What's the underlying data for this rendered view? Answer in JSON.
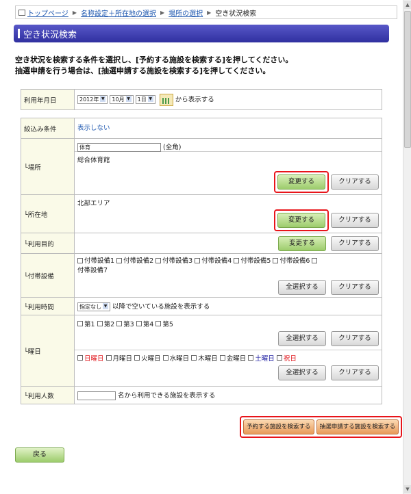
{
  "breadcrumb": {
    "items": [
      "トップページ",
      "名称設定＋所在地の選択",
      "場所の選択"
    ],
    "current": "空き状況検索"
  },
  "title": "空き状況検索",
  "description": {
    "line1": "空き状況を検索する条件を選択し、[予約する施設を検索する]を押してください。",
    "line2": "抽選申請を行う場合は、[抽選申請する施設を検索する]を押してください。"
  },
  "date_row": {
    "label": "利用年月日",
    "year": "2012年",
    "month": "10月",
    "day": "1日",
    "suffix": "から表示する"
  },
  "filter": {
    "label": "絞込み条件",
    "toggle": "表示しない"
  },
  "place": {
    "label": "└場所",
    "input_value": "体育",
    "input_note": "(全角)",
    "selected": "総合体育館",
    "change": "変更する",
    "clear": "クリアする"
  },
  "location": {
    "label": "└所在地",
    "selected": "北部エリア",
    "change": "変更する",
    "clear": "クリアする"
  },
  "purpose": {
    "label": "└利用目的",
    "change": "変更する",
    "clear": "クリアする"
  },
  "equipment": {
    "label": "└付帯設備",
    "items": [
      "付帯設備1",
      "付帯設備2",
      "付帯設備3",
      "付帯設備4",
      "付帯設備5",
      "付帯設備6",
      "付帯設備7"
    ],
    "select_all": "全選択する",
    "clear": "クリアする"
  },
  "time": {
    "label": "└利用時間",
    "select": "指定なし",
    "suffix": "以降で空いている施設を表示する"
  },
  "weekday": {
    "label": "└曜日",
    "weeks": [
      "第1",
      "第2",
      "第3",
      "第4",
      "第5"
    ],
    "days": [
      "日曜日",
      "月曜日",
      "火曜日",
      "水曜日",
      "木曜日",
      "金曜日",
      "土曜日",
      "祝日"
    ],
    "select_all": "全選択する",
    "clear": "クリアする",
    "colors": {
      "sunday": "#e0141a",
      "saturday": "#1a1aa0",
      "holiday": "#e0141a"
    }
  },
  "people": {
    "label": "└利用人数",
    "suffix": "名から利用できる施設を表示する"
  },
  "actions": {
    "search_reserve": "予約する施設を検索する",
    "search_lottery": "抽選申請する施設を検索する",
    "back": "戻る"
  },
  "colors": {
    "title_bar": "#3a3aa8",
    "highlight": "#e8141a",
    "link": "#1f58b0"
  }
}
